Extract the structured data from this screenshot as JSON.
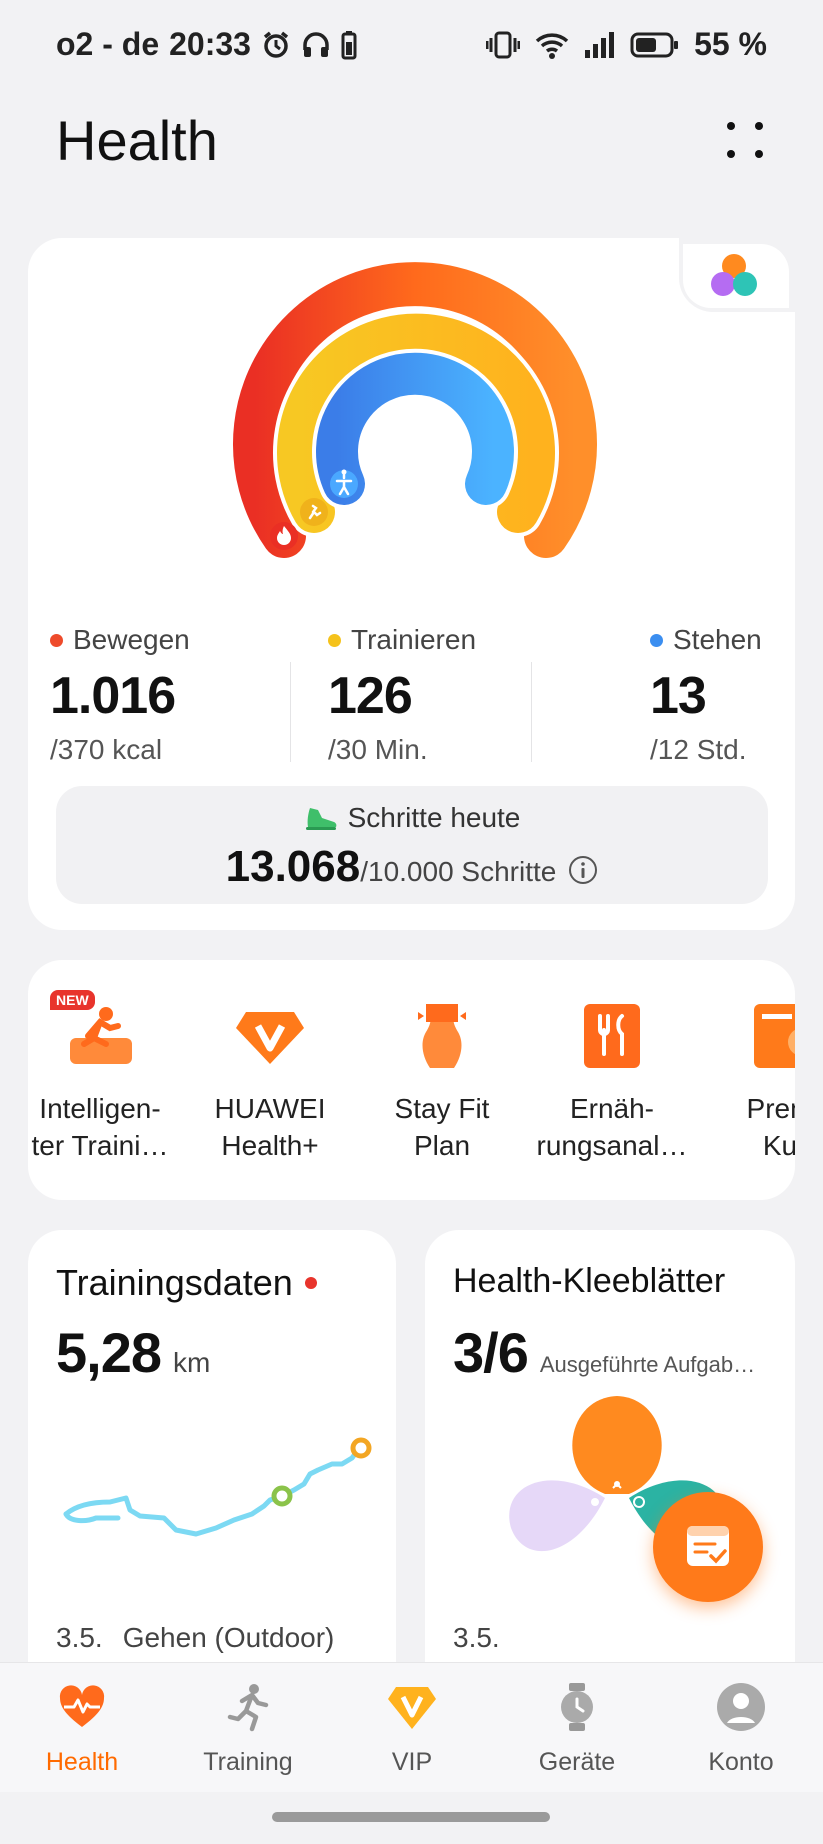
{
  "status_bar": {
    "carrier_time_prefix": "o2 - de",
    "time": "20:33",
    "battery": "55 %",
    "icons": [
      "alarm-icon",
      "headphones-icon",
      "battery-small-icon",
      "vibrate-icon",
      "wifi-icon",
      "signal-icon",
      "battery-icon"
    ]
  },
  "header": {
    "title": "Health",
    "menu_icon": "more-dots-icon"
  },
  "activity": {
    "colors": {
      "move": "#ee4b2b",
      "exercise": "#f5c21b",
      "stand": "#3b8ef0"
    },
    "metrics": [
      {
        "label": "Bewegen",
        "value": "1.016",
        "goal": "/370 kcal"
      },
      {
        "label": "Trainieren",
        "value": "126",
        "goal": "/30 Min."
      },
      {
        "label": "Stehen",
        "value": "13",
        "goal": "/12 Std."
      }
    ],
    "steps": {
      "title": "Schritte heute",
      "count": "13.068",
      "goal": "/10.000 Schritte"
    }
  },
  "shortcuts": [
    {
      "label_line1": "Intelligen-",
      "label_line2": "ter Traini…",
      "badge": "NEW",
      "icon": "running-training-icon"
    },
    {
      "label_line1": "HUAWEI",
      "label_line2": "Health+",
      "icon": "vip-diamond-icon"
    },
    {
      "label_line1": "Stay Fit",
      "label_line2": "Plan",
      "icon": "body-shape-icon"
    },
    {
      "label_line1": "Ernäh-",
      "label_line2": "rungsanal…",
      "icon": "cutlery-icon"
    },
    {
      "label_line1": "Prem",
      "label_line2": "Ku",
      "icon": "course-icon"
    }
  ],
  "training_card": {
    "title": "Trainingsdaten",
    "value": "5,28",
    "unit": "km",
    "date": "3.5.",
    "activity": "Gehen (Outdoor)"
  },
  "clover_card": {
    "title": "Health-Kleeblätter",
    "value": "3/6",
    "subtitle": "Ausgeführte Aufgab…",
    "date": "3.5."
  },
  "nav": [
    {
      "label": "Health",
      "icon": "heart-pulse-icon",
      "active": true
    },
    {
      "label": "Training",
      "icon": "runner-icon",
      "active": false
    },
    {
      "label": "VIP",
      "icon": "vip-icon",
      "active": false
    },
    {
      "label": "Geräte",
      "icon": "watch-icon",
      "active": false
    },
    {
      "label": "Konto",
      "icon": "account-icon",
      "active": false
    }
  ]
}
